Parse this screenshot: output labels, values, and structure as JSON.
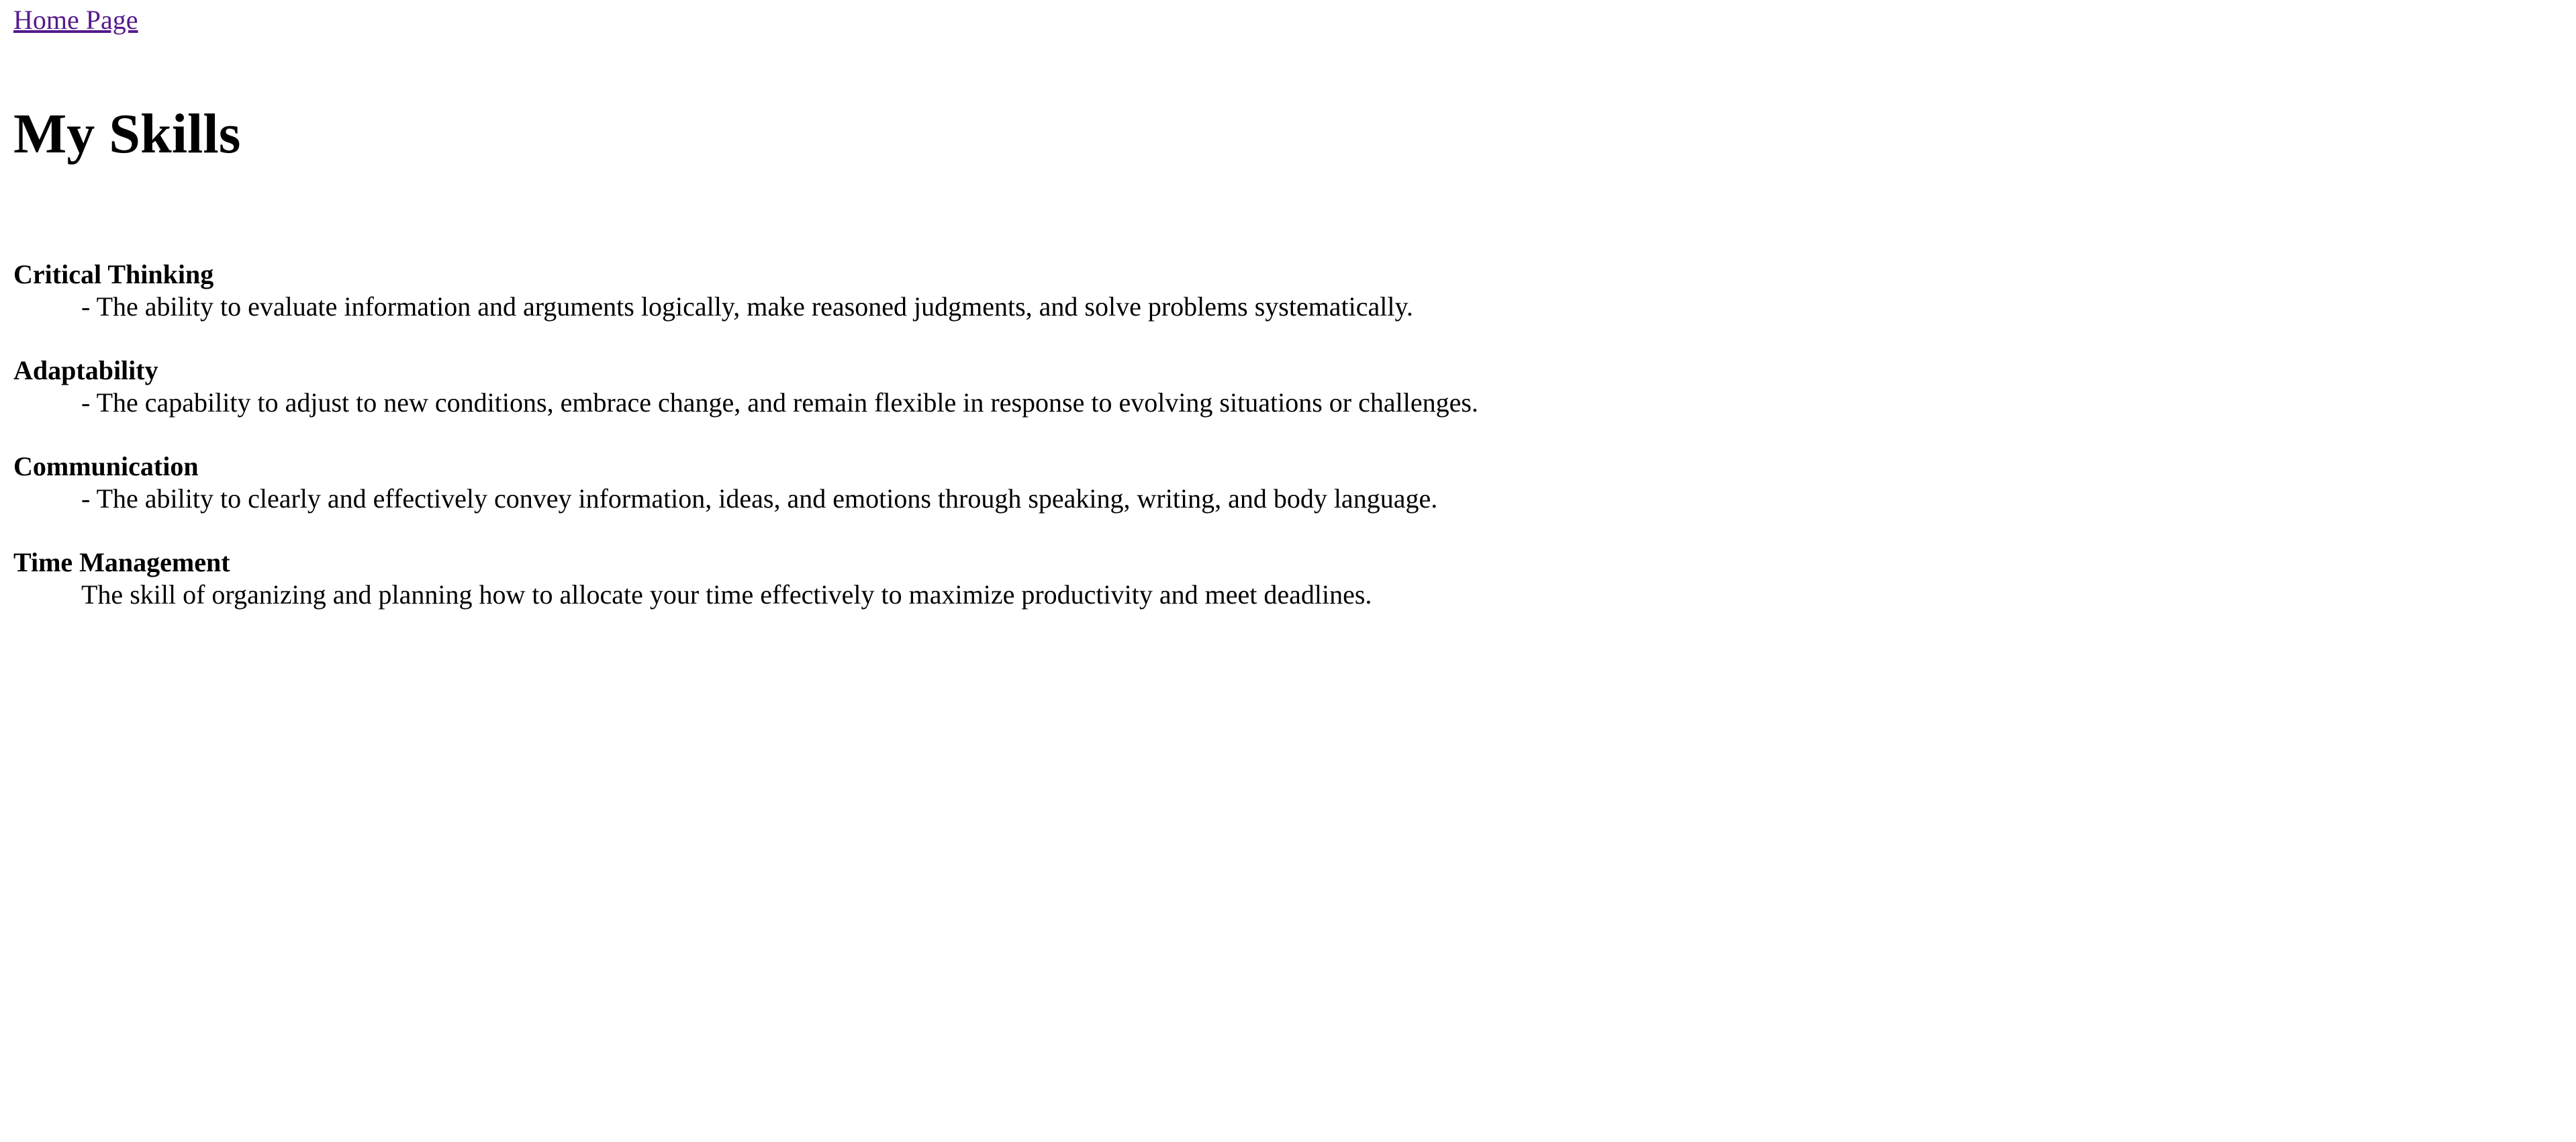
{
  "nav": {
    "home_link": "Home Page"
  },
  "page": {
    "title": "My Skills"
  },
  "skills": [
    {
      "name": "Critical Thinking",
      "description": "- The ability to evaluate information and arguments logically, make reasoned judgments, and solve problems systematically."
    },
    {
      "name": "Adaptability",
      "description": "- The capability to adjust to new conditions, embrace change, and remain flexible in response to evolving situations or challenges."
    },
    {
      "name": "Communication",
      "description": "- The ability to clearly and effectively convey information, ideas, and emotions through speaking, writing, and body language."
    },
    {
      "name": "Time Management",
      "description": "The skill of organizing and planning how to allocate your time effectively to maximize productivity and meet deadlines."
    }
  ],
  "colors": {
    "link_visited": "#551a8b",
    "text": "#000000",
    "background": "#ffffff"
  }
}
